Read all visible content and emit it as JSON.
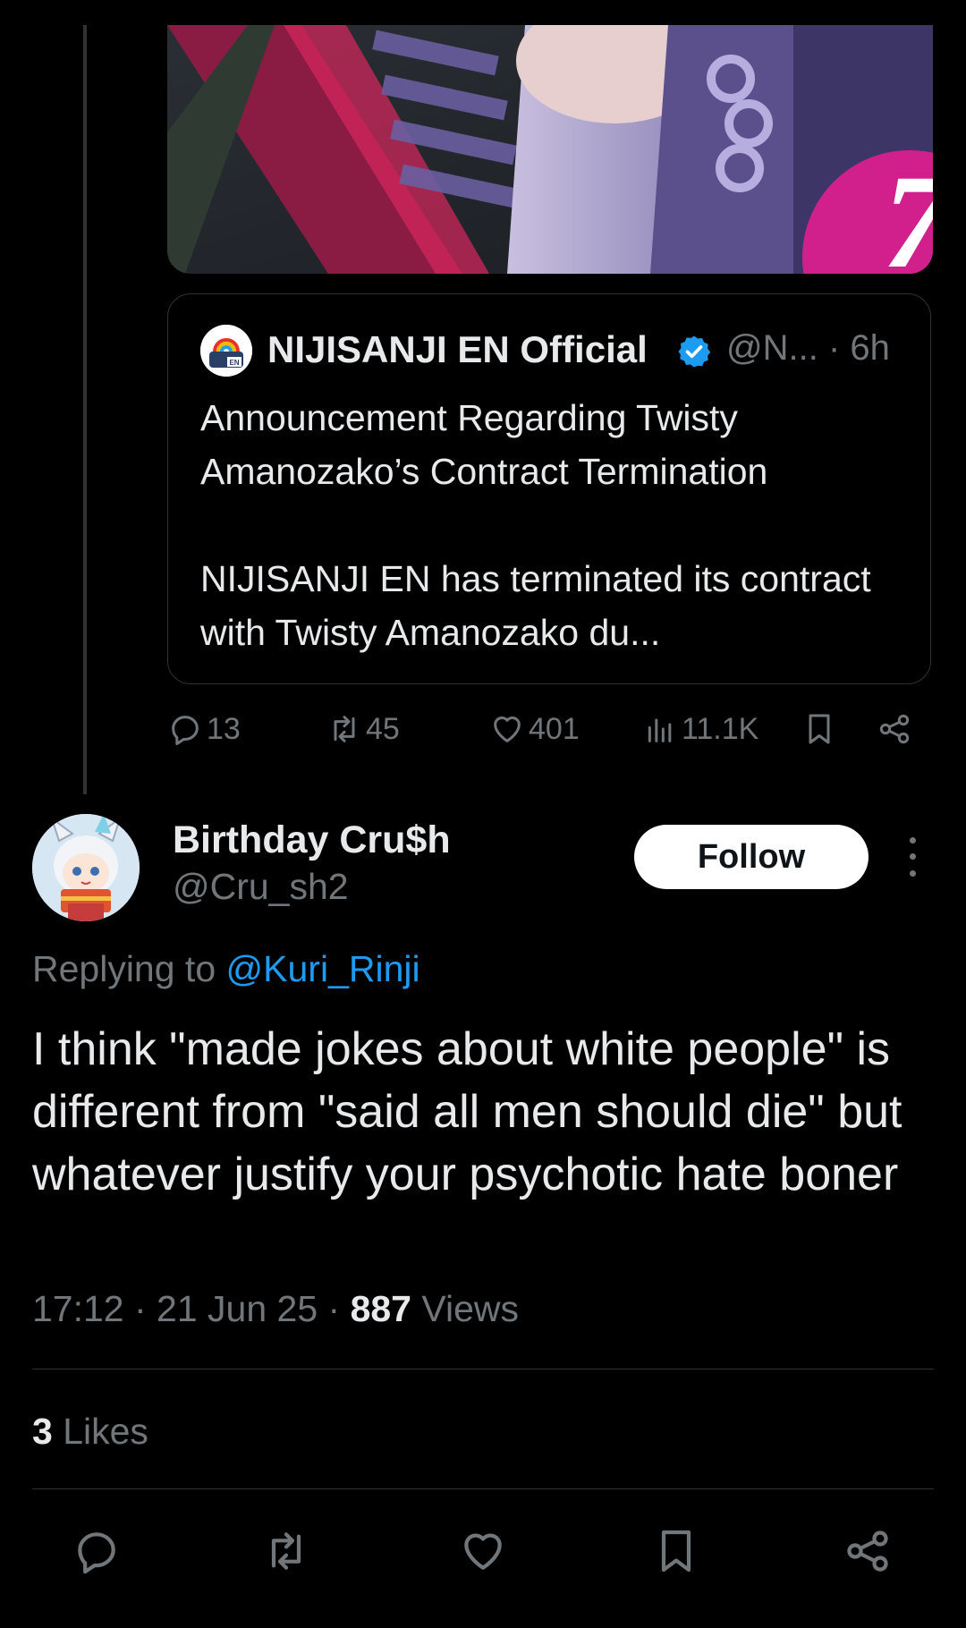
{
  "quoted_tweet": {
    "name": "NIJISANJI EN Official",
    "handle": "@N...",
    "time": "· 6h",
    "avatar_badge": "EN",
    "text": "Announcement Regarding Twisty Amanozako’s Contract Termination\n\nNIJISANJI EN has terminated its contract with Twisty Amanozako du..."
  },
  "media": {
    "corner_text": "7"
  },
  "parent_stats": {
    "replies": "13",
    "reposts": "45",
    "likes": "401",
    "views": "11.1K"
  },
  "reply_tweet": {
    "name": "Birthday Cru$h",
    "handle": "@Cru_sh2",
    "follow_label": "Follow",
    "replying_prefix": "Replying to",
    "replying_handle": "@Kuri_Rinji",
    "text": "I think \"made jokes about white people\" is different from \"said all men should die\" but whatever justify your psychotic hate boner",
    "time": "17:12 · 21 Jun 25 · ",
    "views_count": "887",
    "views_label": " Views",
    "likes_count": "3",
    "likes_label": " Likes"
  },
  "icons": [
    "reply-icon",
    "repost-icon",
    "like-icon",
    "views-icon",
    "bookmark-icon",
    "share-icon",
    "more-icon",
    "verified-icon"
  ],
  "colors": {
    "background": "#000000",
    "text": "#e7e9ea",
    "muted": "#71767b",
    "accent": "#1d9bf0",
    "divider": "#2f3336"
  }
}
